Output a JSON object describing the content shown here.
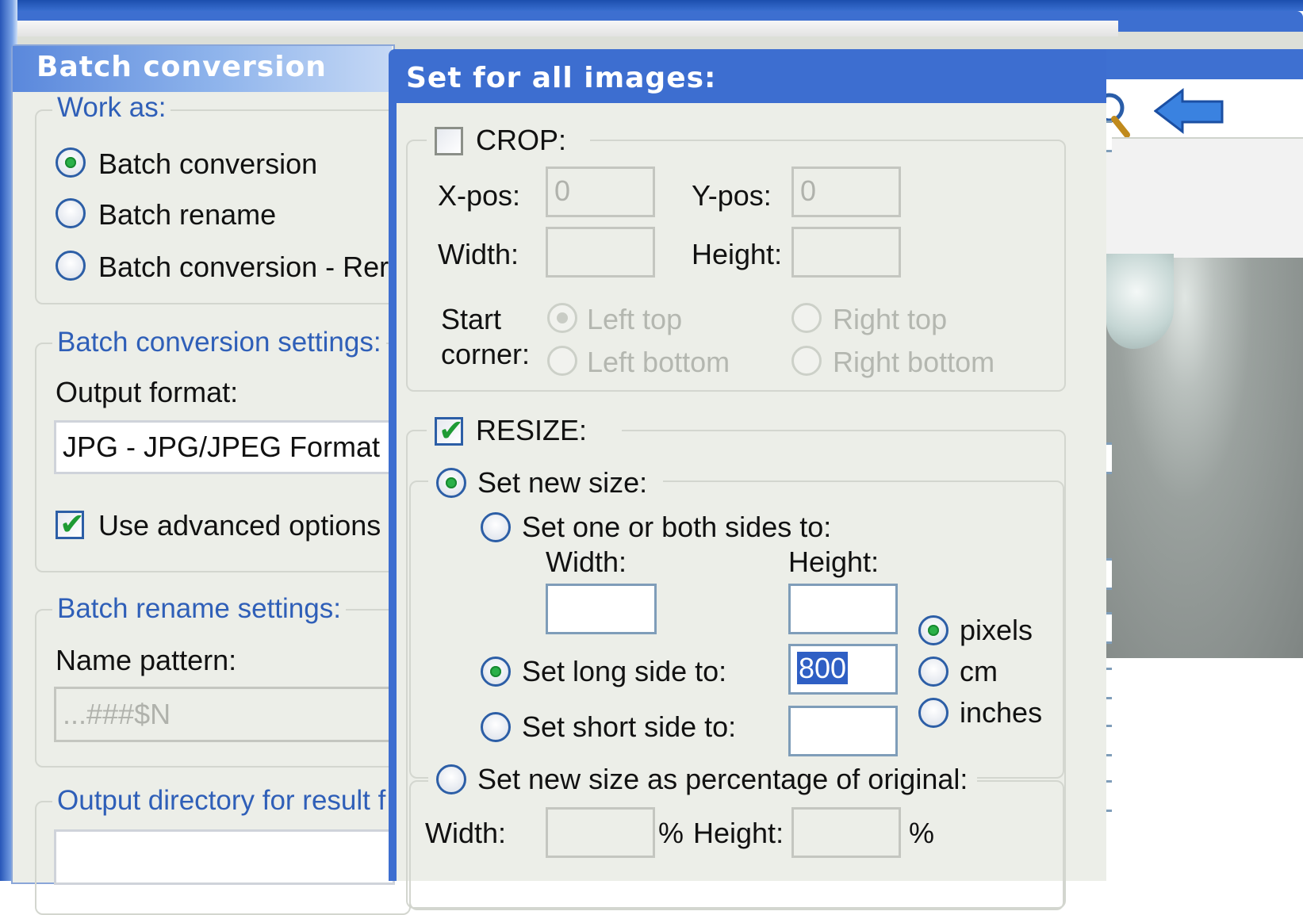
{
  "batch_panel": {
    "title": "Batch conversion",
    "work_as": {
      "legend": "Work as:",
      "options": [
        {
          "label": "Batch conversion",
          "selected": true
        },
        {
          "label": "Batch rename",
          "selected": false
        },
        {
          "label": "Batch conversion - Rer",
          "selected": false
        }
      ]
    },
    "conversion_settings": {
      "legend": "Batch conversion settings:",
      "output_format_label": "Output format:",
      "output_format_value": "JPG - JPG/JPEG Format",
      "advanced_label": "Use advanced options",
      "advanced_checked": true
    },
    "rename_settings": {
      "legend": "Batch rename settings:",
      "name_pattern_label": "Name pattern:",
      "name_pattern_value": "...###$N"
    },
    "output_dir": {
      "legend": "Output directory for result f"
    }
  },
  "dialog": {
    "title": "Set for all images:",
    "crop": {
      "label": "CROP:",
      "checked": false,
      "xpos_label": "X-pos:",
      "xpos_value": "0",
      "ypos_label": "Y-pos:",
      "ypos_value": "0",
      "width_label": "Width:",
      "height_label": "Height:",
      "start_corner_label_1": "Start",
      "start_corner_label_2": "corner:",
      "corners": [
        "Left top",
        "Right top",
        "Left bottom",
        "Right bottom"
      ],
      "selected_corner": "Left top"
    },
    "resize": {
      "label": "RESIZE:",
      "checked": true,
      "set_new_size_label": "Set new size:",
      "one_or_both_label": "Set one or both sides to:",
      "width_label": "Width:",
      "height_label": "Height:",
      "long_side_label": "Set long side to:",
      "long_side_value": "800",
      "short_side_label": "Set short side to:",
      "units": [
        "pixels",
        "cm",
        "inches"
      ],
      "selected_unit": "pixels",
      "percentage_label": "Set new size as percentage of original:",
      "pct_width_label": "Width:",
      "pct_height_label": "Height:",
      "pct_symbol": "%"
    }
  },
  "colors": {
    "title_blue": "#3d6ed0",
    "legend_blue": "#2f5fb8",
    "panel_bg": "#eceee8",
    "radio_green": "#2bb14a"
  }
}
